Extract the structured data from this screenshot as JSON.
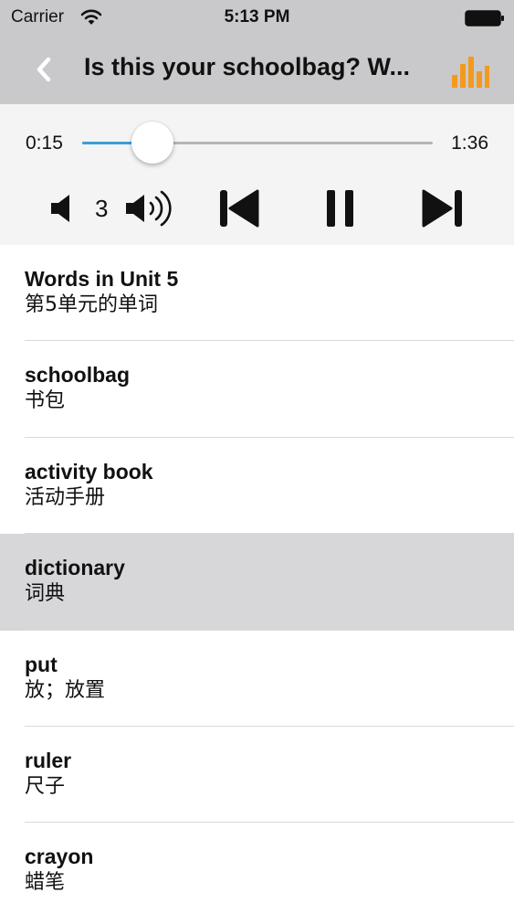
{
  "status_bar": {
    "carrier": "Carrier",
    "time": "5:13 PM"
  },
  "nav": {
    "title": "Is this your schoolbag? W...",
    "accent_color": "#f39a1e"
  },
  "player": {
    "current_time": "0:15",
    "total_time": "1:36",
    "progress": 0.2,
    "volume_level": "3",
    "progress_color": "#3a9fd8"
  },
  "words": [
    {
      "en": "Words in Unit 5",
      "zh": "第5单元的单词",
      "selected": false
    },
    {
      "en": "schoolbag",
      "zh": "书包",
      "selected": false
    },
    {
      "en": "activity book",
      "zh": "活动手册",
      "selected": false
    },
    {
      "en": "dictionary",
      "zh": "词典",
      "selected": true
    },
    {
      "en": "put",
      "zh": "放；放置",
      "selected": false
    },
    {
      "en": "ruler",
      "zh": "尺子",
      "selected": false
    },
    {
      "en": "crayon",
      "zh": "蜡笔",
      "selected": false
    }
  ]
}
